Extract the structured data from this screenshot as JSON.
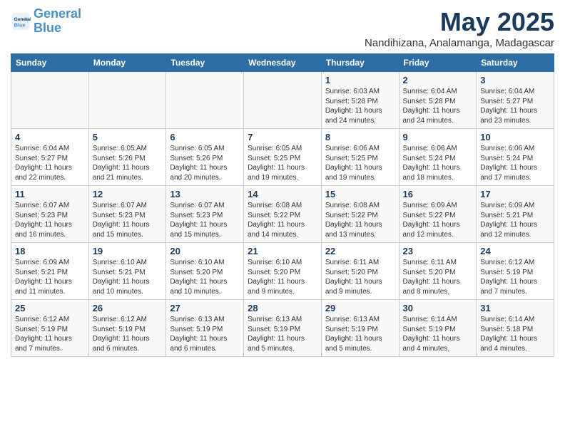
{
  "header": {
    "logo_line1": "General",
    "logo_line2": "Blue",
    "month_year": "May 2025",
    "location": "Nandihizana, Analamanga, Madagascar"
  },
  "days_of_week": [
    "Sunday",
    "Monday",
    "Tuesday",
    "Wednesday",
    "Thursday",
    "Friday",
    "Saturday"
  ],
  "weeks": [
    [
      {
        "day": "",
        "info": ""
      },
      {
        "day": "",
        "info": ""
      },
      {
        "day": "",
        "info": ""
      },
      {
        "day": "",
        "info": ""
      },
      {
        "day": "1",
        "info": "Sunrise: 6:03 AM\nSunset: 5:28 PM\nDaylight: 11 hours\nand 24 minutes."
      },
      {
        "day": "2",
        "info": "Sunrise: 6:04 AM\nSunset: 5:28 PM\nDaylight: 11 hours\nand 24 minutes."
      },
      {
        "day": "3",
        "info": "Sunrise: 6:04 AM\nSunset: 5:27 PM\nDaylight: 11 hours\nand 23 minutes."
      }
    ],
    [
      {
        "day": "4",
        "info": "Sunrise: 6:04 AM\nSunset: 5:27 PM\nDaylight: 11 hours\nand 22 minutes."
      },
      {
        "day": "5",
        "info": "Sunrise: 6:05 AM\nSunset: 5:26 PM\nDaylight: 11 hours\nand 21 minutes."
      },
      {
        "day": "6",
        "info": "Sunrise: 6:05 AM\nSunset: 5:26 PM\nDaylight: 11 hours\nand 20 minutes."
      },
      {
        "day": "7",
        "info": "Sunrise: 6:05 AM\nSunset: 5:25 PM\nDaylight: 11 hours\nand 19 minutes."
      },
      {
        "day": "8",
        "info": "Sunrise: 6:06 AM\nSunset: 5:25 PM\nDaylight: 11 hours\nand 19 minutes."
      },
      {
        "day": "9",
        "info": "Sunrise: 6:06 AM\nSunset: 5:24 PM\nDaylight: 11 hours\nand 18 minutes."
      },
      {
        "day": "10",
        "info": "Sunrise: 6:06 AM\nSunset: 5:24 PM\nDaylight: 11 hours\nand 17 minutes."
      }
    ],
    [
      {
        "day": "11",
        "info": "Sunrise: 6:07 AM\nSunset: 5:23 PM\nDaylight: 11 hours\nand 16 minutes."
      },
      {
        "day": "12",
        "info": "Sunrise: 6:07 AM\nSunset: 5:23 PM\nDaylight: 11 hours\nand 15 minutes."
      },
      {
        "day": "13",
        "info": "Sunrise: 6:07 AM\nSunset: 5:23 PM\nDaylight: 11 hours\nand 15 minutes."
      },
      {
        "day": "14",
        "info": "Sunrise: 6:08 AM\nSunset: 5:22 PM\nDaylight: 11 hours\nand 14 minutes."
      },
      {
        "day": "15",
        "info": "Sunrise: 6:08 AM\nSunset: 5:22 PM\nDaylight: 11 hours\nand 13 minutes."
      },
      {
        "day": "16",
        "info": "Sunrise: 6:09 AM\nSunset: 5:22 PM\nDaylight: 11 hours\nand 12 minutes."
      },
      {
        "day": "17",
        "info": "Sunrise: 6:09 AM\nSunset: 5:21 PM\nDaylight: 11 hours\nand 12 minutes."
      }
    ],
    [
      {
        "day": "18",
        "info": "Sunrise: 6:09 AM\nSunset: 5:21 PM\nDaylight: 11 hours\nand 11 minutes."
      },
      {
        "day": "19",
        "info": "Sunrise: 6:10 AM\nSunset: 5:21 PM\nDaylight: 11 hours\nand 10 minutes."
      },
      {
        "day": "20",
        "info": "Sunrise: 6:10 AM\nSunset: 5:20 PM\nDaylight: 11 hours\nand 10 minutes."
      },
      {
        "day": "21",
        "info": "Sunrise: 6:10 AM\nSunset: 5:20 PM\nDaylight: 11 hours\nand 9 minutes."
      },
      {
        "day": "22",
        "info": "Sunrise: 6:11 AM\nSunset: 5:20 PM\nDaylight: 11 hours\nand 9 minutes."
      },
      {
        "day": "23",
        "info": "Sunrise: 6:11 AM\nSunset: 5:20 PM\nDaylight: 11 hours\nand 8 minutes."
      },
      {
        "day": "24",
        "info": "Sunrise: 6:12 AM\nSunset: 5:19 PM\nDaylight: 11 hours\nand 7 minutes."
      }
    ],
    [
      {
        "day": "25",
        "info": "Sunrise: 6:12 AM\nSunset: 5:19 PM\nDaylight: 11 hours\nand 7 minutes."
      },
      {
        "day": "26",
        "info": "Sunrise: 6:12 AM\nSunset: 5:19 PM\nDaylight: 11 hours\nand 6 minutes."
      },
      {
        "day": "27",
        "info": "Sunrise: 6:13 AM\nSunset: 5:19 PM\nDaylight: 11 hours\nand 6 minutes."
      },
      {
        "day": "28",
        "info": "Sunrise: 6:13 AM\nSunset: 5:19 PM\nDaylight: 11 hours\nand 5 minutes."
      },
      {
        "day": "29",
        "info": "Sunrise: 6:13 AM\nSunset: 5:19 PM\nDaylight: 11 hours\nand 5 minutes."
      },
      {
        "day": "30",
        "info": "Sunrise: 6:14 AM\nSunset: 5:19 PM\nDaylight: 11 hours\nand 4 minutes."
      },
      {
        "day": "31",
        "info": "Sunrise: 6:14 AM\nSunset: 5:18 PM\nDaylight: 11 hours\nand 4 minutes."
      }
    ]
  ]
}
